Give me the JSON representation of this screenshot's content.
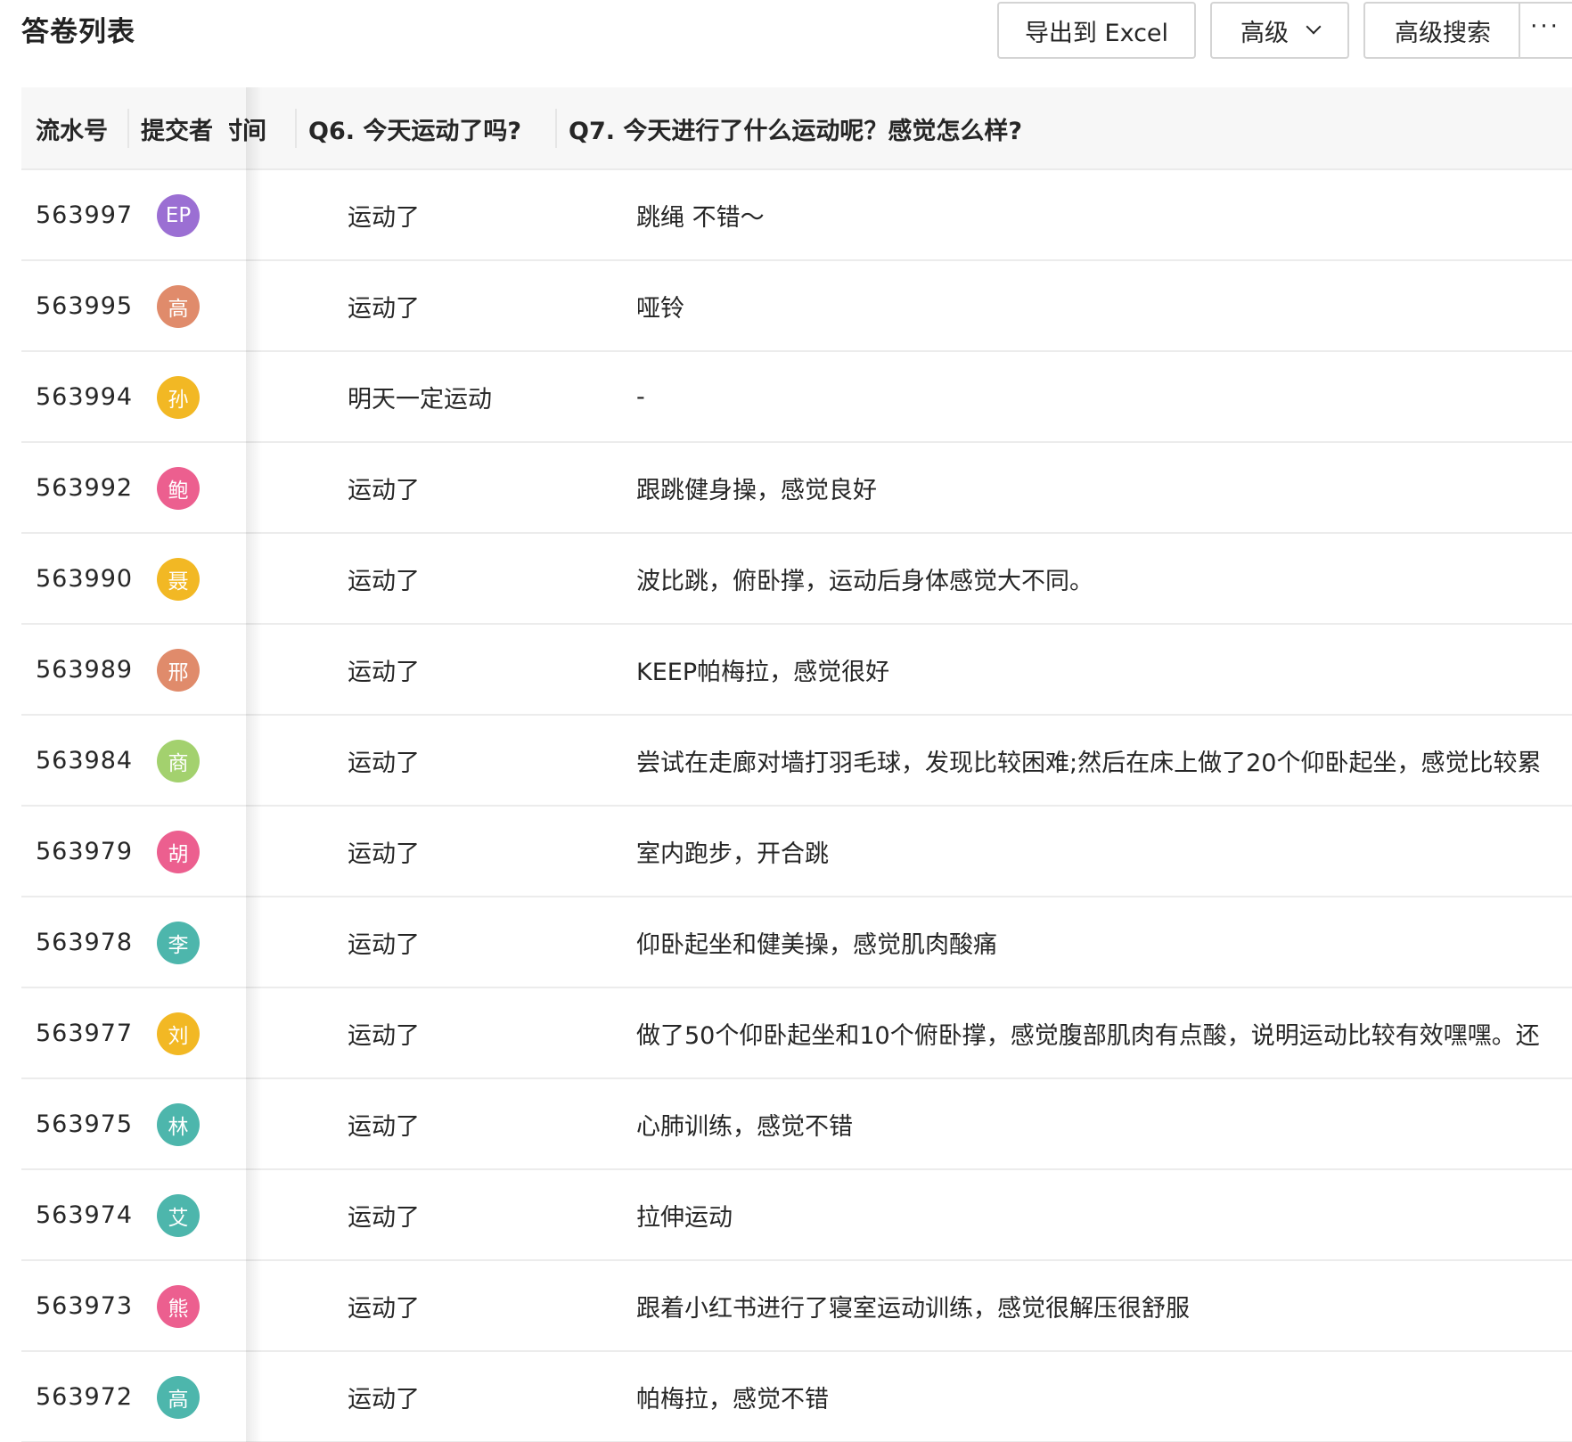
{
  "page": {
    "title": "答卷列表"
  },
  "toolbar": {
    "export_label": "导出到 Excel",
    "advanced_label": "高级",
    "advanced_search_label": "高级搜索",
    "more_label": "···"
  },
  "table": {
    "columns": {
      "serial": "流水号",
      "submitter": "提交者",
      "time": "时间",
      "q6": "Q6. 今天运动了吗?",
      "q7": "Q7. 今天进行了什么运动呢？感觉怎么样?"
    },
    "rows": [
      {
        "serial": "563997",
        "avatar_text": "EP",
        "avatar_color": "#9b6fd3",
        "q6": "运动了",
        "q7": "跳绳 不错～"
      },
      {
        "serial": "563995",
        "avatar_text": "高",
        "avatar_color": "#e08b6b",
        "q6": "运动了",
        "q7": "哑铃"
      },
      {
        "serial": "563994",
        "avatar_text": "孙",
        "avatar_color": "#f2b824",
        "q6": "明天一定运动",
        "q7": "-"
      },
      {
        "serial": "563992",
        "avatar_text": "鲍",
        "avatar_color": "#ec5f8f",
        "q6": "运动了",
        "q7": "跟跳健身操，感觉良好"
      },
      {
        "serial": "563990",
        "avatar_text": "聂",
        "avatar_color": "#f2b824",
        "q6": "运动了",
        "q7": "波比跳，俯卧撑，运动后身体感觉大不同。"
      },
      {
        "serial": "563989",
        "avatar_text": "邢",
        "avatar_color": "#e08b6b",
        "q6": "运动了",
        "q7": "KEEP帕梅拉，感觉很好"
      },
      {
        "serial": "563984",
        "avatar_text": "商",
        "avatar_color": "#a3d16e",
        "q6": "运动了",
        "q7": "尝试在走廊对墙打羽毛球，发现比较困难;然后在床上做了20个仰卧起坐，感觉比较累"
      },
      {
        "serial": "563979",
        "avatar_text": "胡",
        "avatar_color": "#ec5f8f",
        "q6": "运动了",
        "q7": "室内跑步，开合跳"
      },
      {
        "serial": "563978",
        "avatar_text": "李",
        "avatar_color": "#4db6ac",
        "q6": "运动了",
        "q7": "仰卧起坐和健美操，感觉肌肉酸痛"
      },
      {
        "serial": "563977",
        "avatar_text": "刘",
        "avatar_color": "#f2b824",
        "q6": "运动了",
        "q7": "做了50个仰卧起坐和10个俯卧撑，感觉腹部肌肉有点酸，说明运动比较有效嘿嘿。还"
      },
      {
        "serial": "563975",
        "avatar_text": "林",
        "avatar_color": "#4db6ac",
        "q6": "运动了",
        "q7": "心肺训练，感觉不错"
      },
      {
        "serial": "563974",
        "avatar_text": "艾",
        "avatar_color": "#4db6ac",
        "q6": "运动了",
        "q7": "拉伸运动"
      },
      {
        "serial": "563973",
        "avatar_text": "熊",
        "avatar_color": "#ec5f8f",
        "q6": "运动了",
        "q7": "跟着小红书进行了寝室运动训练，感觉很解压很舒服"
      },
      {
        "serial": "563972",
        "avatar_text": "高",
        "avatar_color": "#4db6ac",
        "q6": "运动了",
        "q7": "帕梅拉，感觉不错"
      }
    ]
  }
}
